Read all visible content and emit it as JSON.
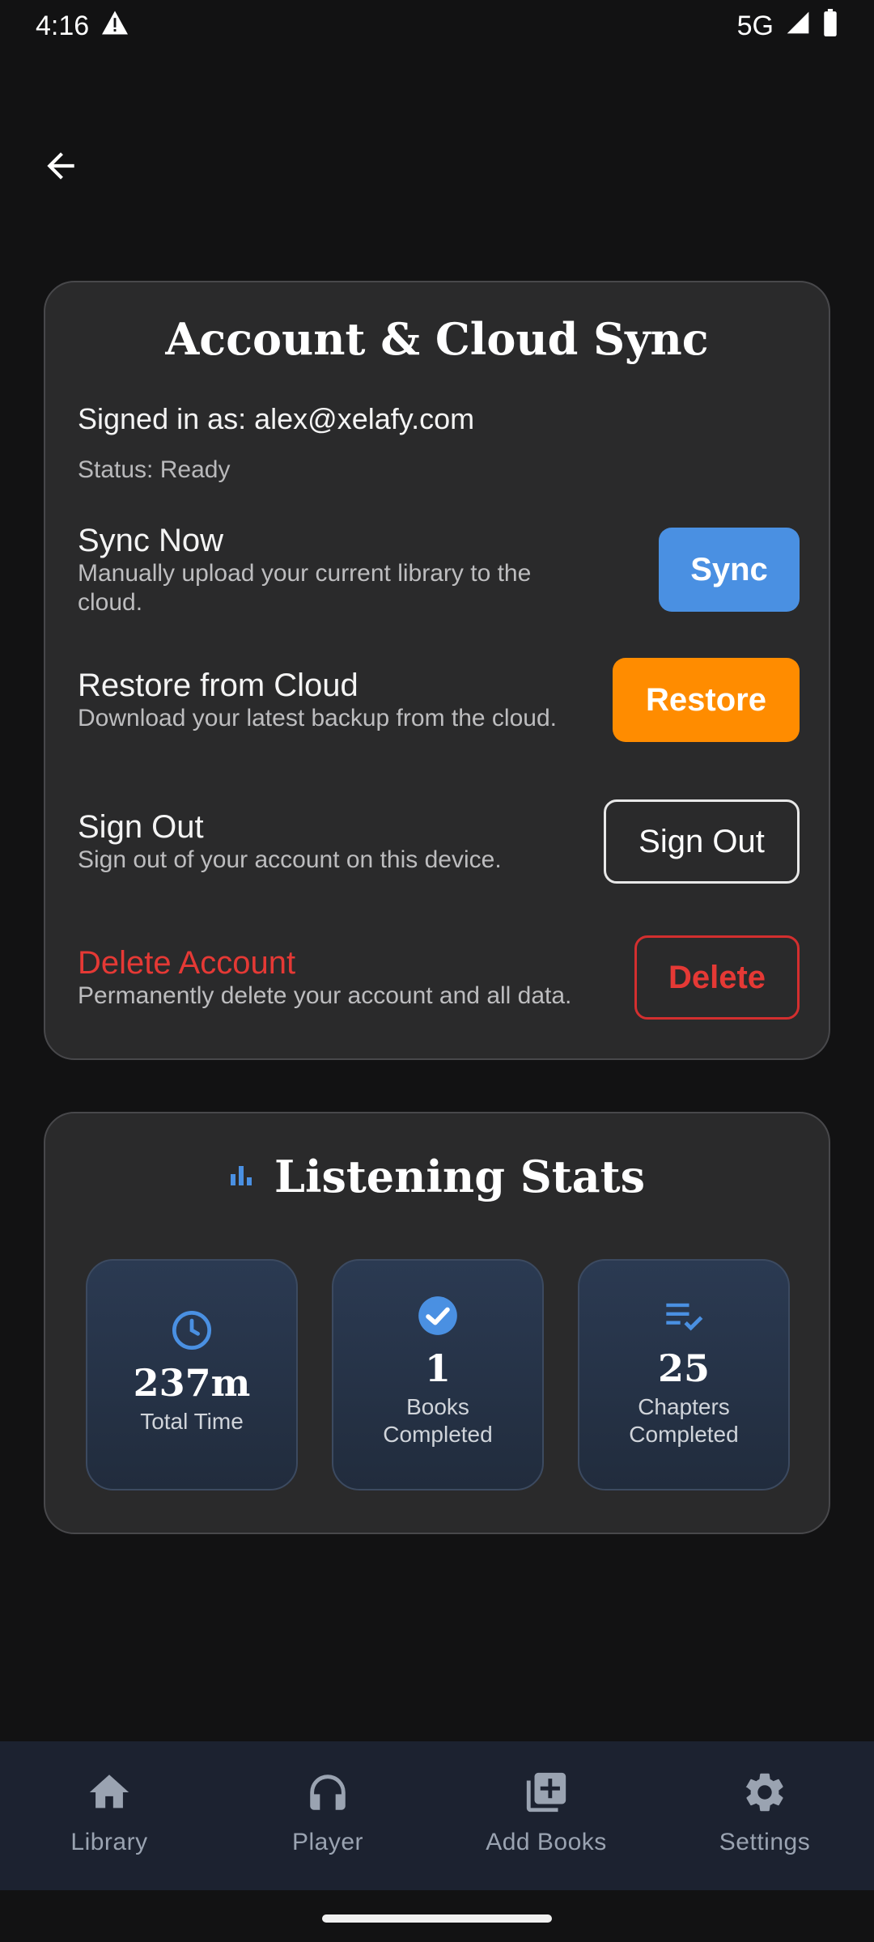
{
  "status_bar": {
    "time": "4:16",
    "network": "5G"
  },
  "account_card": {
    "title": "Account & Cloud Sync",
    "signed_in": "Signed in as: alex@xelafy.com",
    "status": "Status: Ready",
    "rows": [
      {
        "title": "Sync Now",
        "description": "Manually upload your current library to the cloud.",
        "button": "Sync"
      },
      {
        "title": "Restore from Cloud",
        "description": "Download your latest backup from the cloud.",
        "button": "Restore"
      },
      {
        "title": "Sign Out",
        "description": "Sign out of your account on this device.",
        "button": "Sign Out"
      },
      {
        "title": "Delete Account",
        "description": "Permanently delete your account and all data.",
        "button": "Delete"
      }
    ]
  },
  "stats_card": {
    "title": "Listening Stats",
    "items": [
      {
        "icon": "clock-icon",
        "value": "237m",
        "label": "Total Time"
      },
      {
        "icon": "check-circle-icon",
        "value": "1",
        "label": "Books Completed"
      },
      {
        "icon": "playlist-check-icon",
        "value": "25",
        "label": "Chapters Completed"
      }
    ]
  },
  "bottom_nav": [
    {
      "icon": "home-icon",
      "label": "Library"
    },
    {
      "icon": "headphones-icon",
      "label": "Player"
    },
    {
      "icon": "library-add-icon",
      "label": "Add Books"
    },
    {
      "icon": "gear-icon",
      "label": "Settings"
    }
  ],
  "colors": {
    "background": "#121213",
    "card": "#2a2a2b",
    "accent_blue": "#4a90e2",
    "accent_orange": "#ff8c00",
    "danger": "#e53935",
    "nav_background": "#1c2230"
  }
}
